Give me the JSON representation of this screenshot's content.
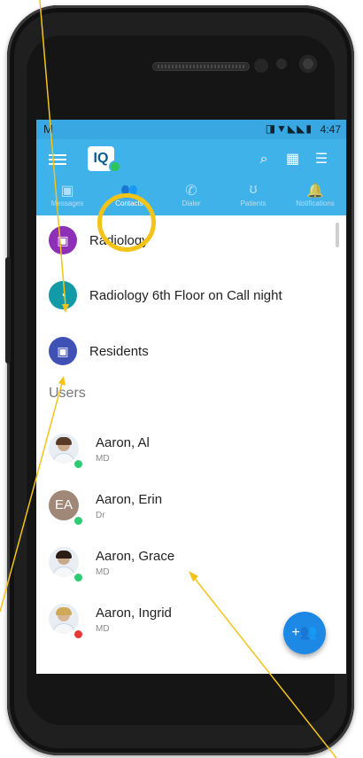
{
  "status_bar": {
    "left_icon": "M",
    "icons": "◨▼◣◣▮",
    "time": "4:47"
  },
  "app_bar": {
    "logo_text": "IQ",
    "icons": [
      "search-icon",
      "building-icon",
      "filter-icon"
    ]
  },
  "tabs": [
    {
      "label": "Messages",
      "icon": "chat-icon",
      "active": false
    },
    {
      "label": "Contacts",
      "icon": "people-icon",
      "active": true
    },
    {
      "label": "Dialer",
      "icon": "phone-icon",
      "active": false
    },
    {
      "label": "Patients",
      "icon": "stethoscope-icon",
      "active": false
    },
    {
      "label": "Notifications",
      "icon": "bell-icon",
      "active": false
    }
  ],
  "groups": [
    {
      "name": "Radiology",
      "icon": "calendar-icon",
      "color": "#8e2fb7"
    },
    {
      "name": "Radiology 6th Floor on Call night",
      "icon": "wifi-icon",
      "color": "#129aa6"
    },
    {
      "name": "Residents",
      "icon": "calendar-icon",
      "color": "#3f51b5"
    }
  ],
  "section_users": "Users",
  "users": [
    {
      "name": "Aaron, Al",
      "title": "MD",
      "presence": "#2ecc71",
      "avatar": "photo"
    },
    {
      "name": "Aaron, Erin",
      "title": "Dr",
      "presence": "#2ecc71",
      "avatar": "EA",
      "avatar_color": "#a08878"
    },
    {
      "name": "Aaron, Grace",
      "title": "MD",
      "presence": "#2ecc71",
      "avatar": "photo"
    },
    {
      "name": "Aaron, Ingrid",
      "title": "MD",
      "presence": "#e53935",
      "avatar": "photo"
    }
  ],
  "fab": {
    "icon": "add-group-icon"
  },
  "colors": {
    "app_bar": "#3fb2ea",
    "status_bar": "#39a7e1",
    "annotation": "#f3c318",
    "fab": "#1e88e5"
  }
}
